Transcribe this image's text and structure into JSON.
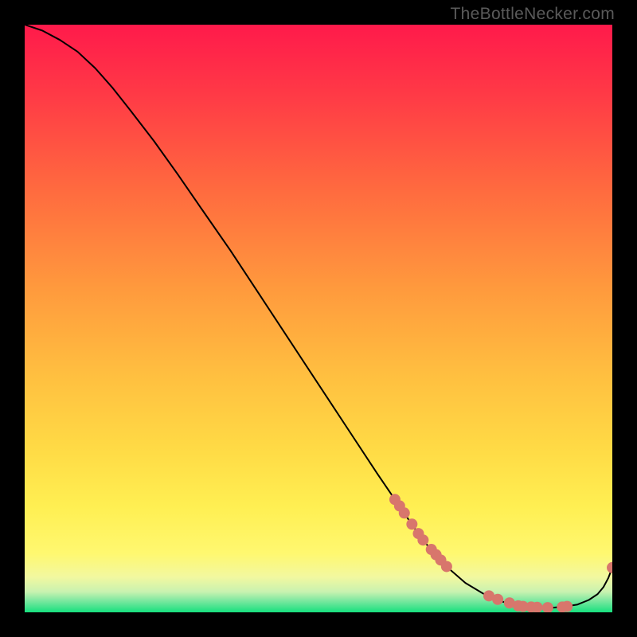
{
  "watermark": "TheBottleNecker.com",
  "chart_data": {
    "type": "line",
    "title": "",
    "xlabel": "",
    "ylabel": "",
    "xlim": [
      0,
      100
    ],
    "ylim": [
      0,
      100
    ],
    "legend": false,
    "grid": false,
    "background_gradient": {
      "top_color": "#ff1a4b",
      "mid_color": "#ffd24a",
      "bottom_band_color": "#17e07e"
    },
    "series": [
      {
        "name": "curve",
        "color": "#000000",
        "x": [
          0,
          3,
          6,
          9,
          12,
          15,
          18,
          22,
          26,
          30,
          35,
          40,
          45,
          50,
          55,
          60,
          63,
          66,
          68,
          70,
          72,
          75,
          78,
          81,
          84,
          86,
          88,
          89,
          90,
          92,
          94,
          96,
          97.5,
          98.5,
          99.3,
          100
        ],
        "y": [
          100,
          99,
          97.4,
          95.4,
          92.6,
          89.2,
          85.4,
          80.2,
          74.6,
          68.8,
          61.6,
          54,
          46.4,
          38.8,
          31.2,
          23.6,
          19.2,
          14.8,
          12,
          9.8,
          7.6,
          5,
          3.2,
          1.9,
          1.1,
          0.9,
          0.8,
          0.8,
          0.8,
          1,
          1.3,
          2.1,
          3.1,
          4.3,
          5.8,
          7.6
        ]
      }
    ],
    "markers": {
      "name": "dots",
      "color": "#d8766c",
      "radius_px": 7,
      "points": [
        {
          "x": 63.0,
          "y": 19.2
        },
        {
          "x": 63.8,
          "y": 18.1
        },
        {
          "x": 64.6,
          "y": 16.9
        },
        {
          "x": 65.9,
          "y": 15.0
        },
        {
          "x": 67.0,
          "y": 13.4
        },
        {
          "x": 67.8,
          "y": 12.3
        },
        {
          "x": 69.2,
          "y": 10.7
        },
        {
          "x": 70.0,
          "y": 9.8
        },
        {
          "x": 70.8,
          "y": 8.9
        },
        {
          "x": 71.8,
          "y": 7.8
        },
        {
          "x": 79.0,
          "y": 2.8
        },
        {
          "x": 80.5,
          "y": 2.2
        },
        {
          "x": 82.5,
          "y": 1.6
        },
        {
          "x": 84.0,
          "y": 1.1
        },
        {
          "x": 84.8,
          "y": 1.0
        },
        {
          "x": 86.2,
          "y": 0.9
        },
        {
          "x": 87.2,
          "y": 0.85
        },
        {
          "x": 89.0,
          "y": 0.8
        },
        {
          "x": 91.5,
          "y": 0.9
        },
        {
          "x": 92.3,
          "y": 1.0
        },
        {
          "x": 100.0,
          "y": 7.6
        }
      ]
    }
  }
}
